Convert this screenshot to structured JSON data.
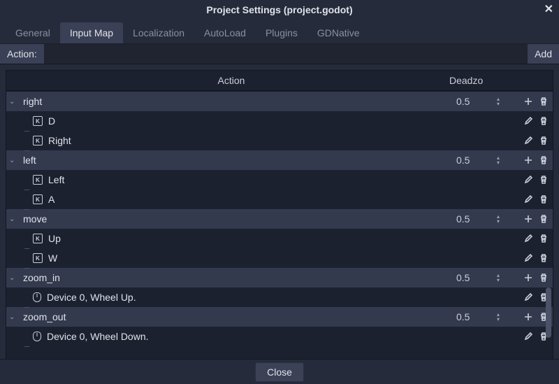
{
  "window": {
    "title": "Project Settings (project.godot)"
  },
  "tabs": [
    "General",
    "Input Map",
    "Localization",
    "AutoLoad",
    "Plugins",
    "GDNative"
  ],
  "active_tab": 1,
  "action_bar": {
    "label": "Action:",
    "add": "Add",
    "value": ""
  },
  "columns": {
    "action": "Action",
    "deadzone": "Deadzo"
  },
  "footer": {
    "close": "Close"
  },
  "actions": [
    {
      "name": "right",
      "deadzone": "0.5",
      "events": [
        {
          "type": "key",
          "label": "D"
        },
        {
          "type": "key",
          "label": "Right"
        }
      ]
    },
    {
      "name": "left",
      "deadzone": "0.5",
      "events": [
        {
          "type": "key",
          "label": "Left"
        },
        {
          "type": "key",
          "label": "A"
        }
      ]
    },
    {
      "name": "move",
      "deadzone": "0.5",
      "events": [
        {
          "type": "key",
          "label": "Up"
        },
        {
          "type": "key",
          "label": "W"
        }
      ]
    },
    {
      "name": "zoom_in",
      "deadzone": "0.5",
      "events": [
        {
          "type": "mouse",
          "label": "Device 0, Wheel Up."
        }
      ]
    },
    {
      "name": "zoom_out",
      "deadzone": "0.5",
      "events": [
        {
          "type": "mouse",
          "label": "Device 0, Wheel Down."
        }
      ]
    }
  ]
}
